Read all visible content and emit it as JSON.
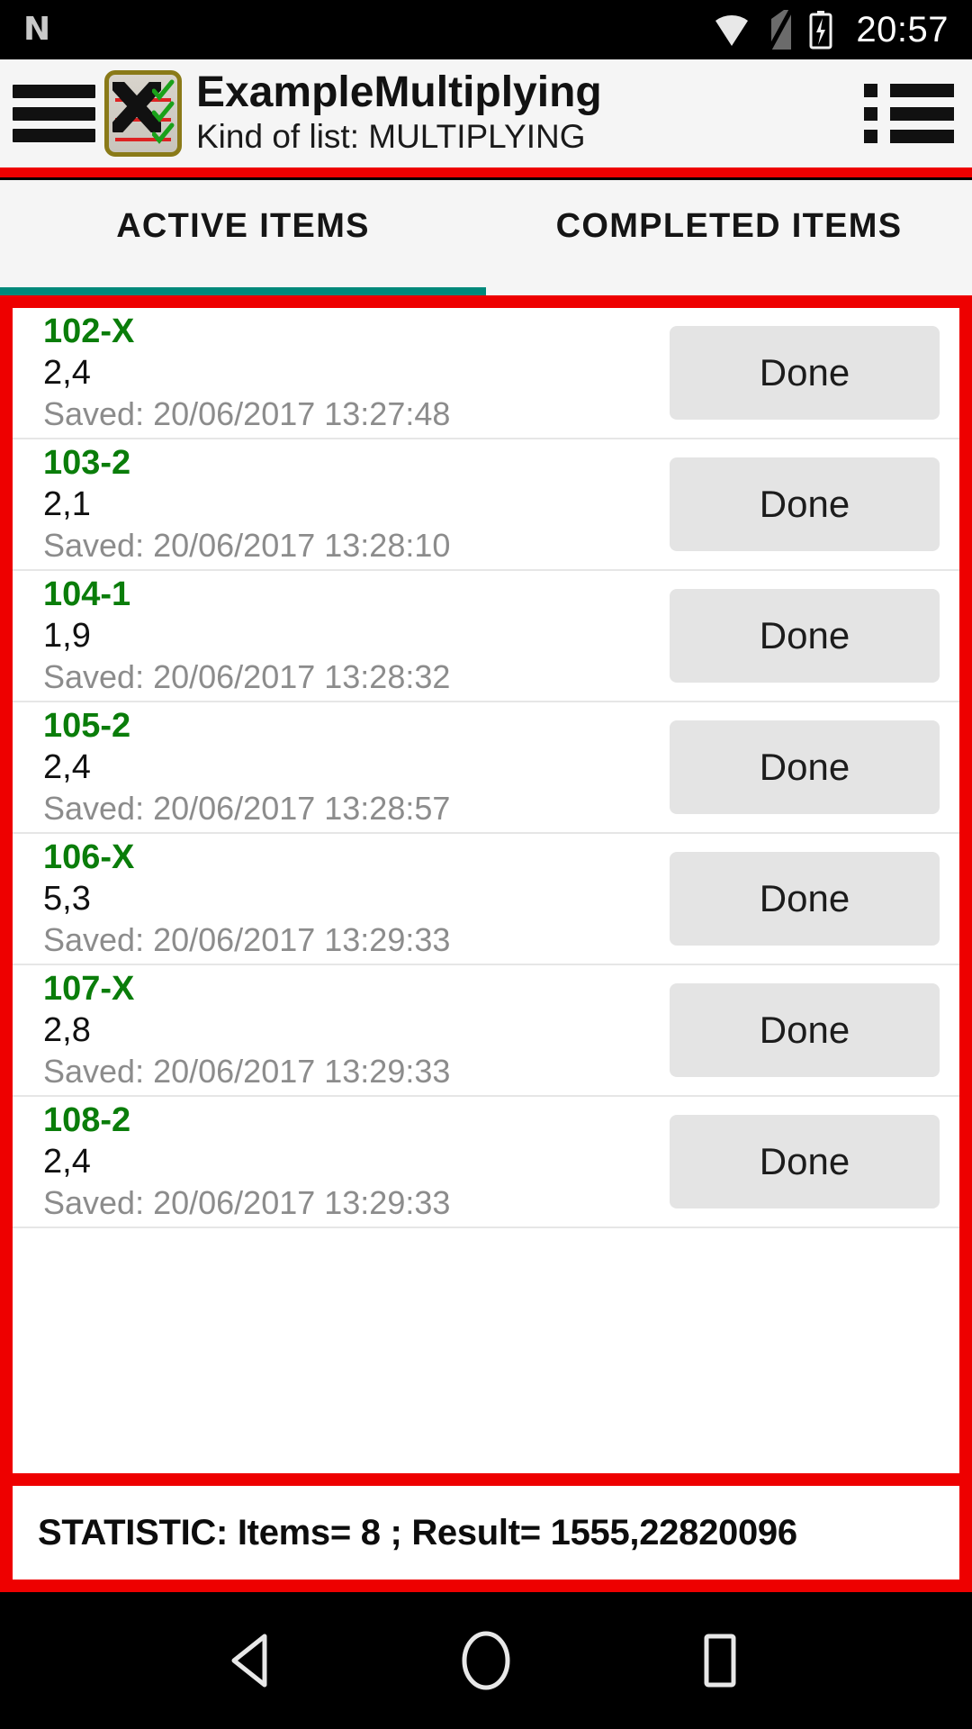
{
  "status_bar": {
    "notification_icon": "n-logo-icon",
    "wifi_icon": "wifi-icon",
    "sim_icon": "no-sim-icon",
    "battery_icon": "battery-charging-icon",
    "time": "20:57"
  },
  "action_bar": {
    "menu_icon": "hamburger-menu-icon",
    "app_icon": "checklist-x-app-icon",
    "title": "ExampleMultiplying",
    "subtitle": "Kind of list: MULTIPLYING",
    "overflow_icon": "list-view-icon"
  },
  "tabs": [
    {
      "label": "ACTIVE ITEMS",
      "selected": true
    },
    {
      "label": "COMPLETED ITEMS",
      "selected": false
    }
  ],
  "list": {
    "done_label": "Done",
    "items": [
      {
        "title": "102-X",
        "value": "2,4",
        "saved": "Saved: 20/06/2017 13:27:48"
      },
      {
        "title": "103-2",
        "value": "2,1",
        "saved": "Saved: 20/06/2017 13:28:10"
      },
      {
        "title": "104-1",
        "value": "1,9",
        "saved": "Saved: 20/06/2017 13:28:32"
      },
      {
        "title": "105-2",
        "value": "2,4",
        "saved": "Saved: 20/06/2017 13:28:57"
      },
      {
        "title": "106-X",
        "value": "5,3",
        "saved": "Saved: 20/06/2017 13:29:33"
      },
      {
        "title": "107-X",
        "value": "2,8",
        "saved": "Saved: 20/06/2017 13:29:33"
      },
      {
        "title": "108-2",
        "value": "2,4",
        "saved": "Saved: 20/06/2017 13:29:33"
      }
    ]
  },
  "statistic": {
    "text": "STATISTIC: Items= 8 ; Result= 1555,22820096",
    "items_count": "8",
    "result": "1555,22820096"
  },
  "nav_bar": {
    "back_icon": "back-triangle-icon",
    "home_icon": "home-circle-icon",
    "recents_icon": "recents-square-icon"
  },
  "colors": {
    "accent_red": "#ee0000",
    "tab_indicator_teal": "#00897b",
    "item_title_green": "#0a7d0a",
    "saved_gray": "#8c8c8c",
    "action_bar_bg": "#f5f5f5",
    "done_button_bg": "#e4e4e4"
  }
}
